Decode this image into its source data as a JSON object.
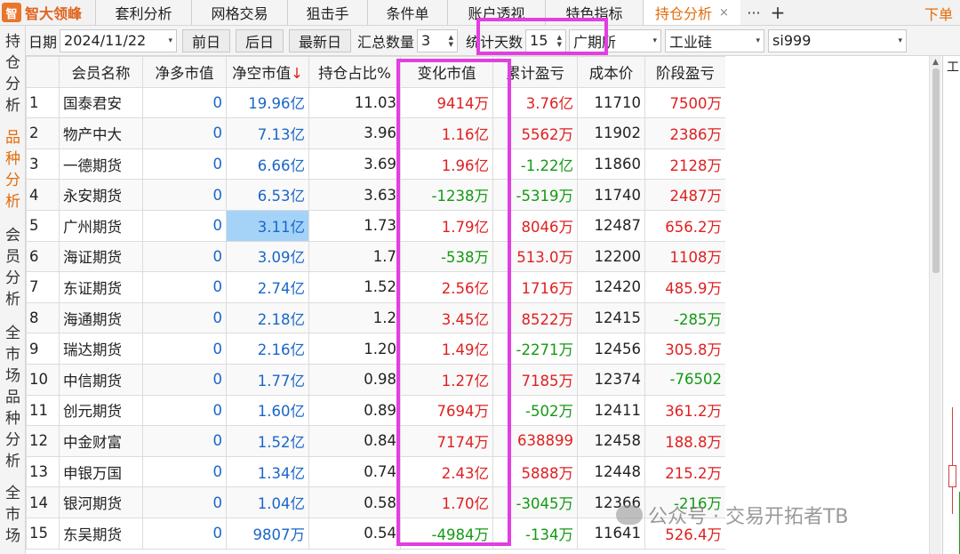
{
  "app": {
    "logo_mark": "智",
    "name": "智大领峰"
  },
  "tabs": [
    {
      "label": "套利分析"
    },
    {
      "label": "网格交易"
    },
    {
      "label": "狙击手"
    },
    {
      "label": "条件单"
    },
    {
      "label": "账户透视"
    },
    {
      "label": "特色指标"
    },
    {
      "label": "持仓分析",
      "active": true,
      "close": "×"
    }
  ],
  "tab_more": "···",
  "tab_add": "+",
  "order_button": "下单",
  "left_nav": [
    {
      "label": [
        "持",
        "仓",
        "分",
        "析"
      ]
    },
    {
      "label": [
        "品",
        "种",
        "分",
        "析"
      ],
      "active": true
    },
    {
      "label": [
        "会",
        "员",
        "分",
        "析"
      ]
    },
    {
      "label": [
        "全",
        "市",
        "场",
        "品",
        "种",
        "分",
        "析"
      ]
    },
    {
      "label": [
        "全",
        "市",
        "场"
      ]
    }
  ],
  "toolbar": {
    "date_label": "日期",
    "date_value": "2024/11/22",
    "prev_day": "前日",
    "next_day": "后日",
    "latest_day": "最新日",
    "sum_label": "汇总数量",
    "sum_value": "3",
    "days_label": "统计天数",
    "days_value": "15",
    "exchange_value": "广期所",
    "product_value": "工业硅",
    "contract_value": "si999"
  },
  "table": {
    "headers": [
      "会员名称",
      "净多市值",
      "净空市值",
      "持仓占比%",
      "变化市值",
      "累计盈亏",
      "成本价",
      "阶段盈亏"
    ],
    "sort_arrow": "↓",
    "rows": [
      {
        "idx": "1",
        "name": "国泰君安",
        "long": "0",
        "short": "19.96亿",
        "ratio": "11.03",
        "change": "9414万",
        "cum": "3.76亿",
        "cost": "11710",
        "stage": "7500万"
      },
      {
        "idx": "2",
        "name": "物产中大",
        "long": "0",
        "short": "7.13亿",
        "ratio": "3.96",
        "change": "1.16亿",
        "cum": "5562万",
        "cost": "11902",
        "stage": "2386万"
      },
      {
        "idx": "3",
        "name": "一德期货",
        "long": "0",
        "short": "6.66亿",
        "ratio": "3.69",
        "change": "1.96亿",
        "cum": "-1.22亿",
        "cost": "11860",
        "stage": "2128万"
      },
      {
        "idx": "4",
        "name": "永安期货",
        "long": "0",
        "short": "6.53亿",
        "ratio": "3.63",
        "change": "-1238万",
        "cum": "-5319万",
        "cost": "11740",
        "stage": "2487万"
      },
      {
        "idx": "5",
        "name": "广州期货",
        "long": "0",
        "short": "3.11亿",
        "ratio": "1.73",
        "change": "1.79亿",
        "cum": "8046万",
        "cost": "12487",
        "stage": "656.2万"
      },
      {
        "idx": "6",
        "name": "海证期货",
        "long": "0",
        "short": "3.09亿",
        "ratio": "1.7",
        "change": "-538万",
        "cum": "513.0万",
        "cost": "12200",
        "stage": "1108万"
      },
      {
        "idx": "7",
        "name": "东证期货",
        "long": "0",
        "short": "2.74亿",
        "ratio": "1.52",
        "change": "2.56亿",
        "cum": "1716万",
        "cost": "12420",
        "stage": "485.9万"
      },
      {
        "idx": "8",
        "name": "海通期货",
        "long": "0",
        "short": "2.18亿",
        "ratio": "1.2",
        "change": "3.45亿",
        "cum": "8522万",
        "cost": "12415",
        "stage": "-285万"
      },
      {
        "idx": "9",
        "name": "瑞达期货",
        "long": "0",
        "short": "2.16亿",
        "ratio": "1.20",
        "change": "1.49亿",
        "cum": "-2271万",
        "cost": "12456",
        "stage": "305.8万"
      },
      {
        "idx": "10",
        "name": "中信期货",
        "long": "0",
        "short": "1.77亿",
        "ratio": "0.98",
        "change": "1.27亿",
        "cum": "7185万",
        "cost": "12374",
        "stage": "-76502"
      },
      {
        "idx": "11",
        "name": "创元期货",
        "long": "0",
        "short": "1.60亿",
        "ratio": "0.89",
        "change": "7694万",
        "cum": "-502万",
        "cost": "12411",
        "stage": "361.2万"
      },
      {
        "idx": "12",
        "name": "中金财富",
        "long": "0",
        "short": "1.52亿",
        "ratio": "0.84",
        "change": "7174万",
        "cum": "638899",
        "cost": "12458",
        "stage": "188.8万"
      },
      {
        "idx": "13",
        "name": "申银万国",
        "long": "0",
        "short": "1.34亿",
        "ratio": "0.74",
        "change": "2.43亿",
        "cum": "5888万",
        "cost": "12448",
        "stage": "215.2万"
      },
      {
        "idx": "14",
        "name": "银河期货",
        "long": "0",
        "short": "1.04亿",
        "ratio": "0.58",
        "change": "1.70亿",
        "cum": "-3045万",
        "cost": "12366",
        "stage": "-216万"
      },
      {
        "idx": "15",
        "name": "东吴期货",
        "long": "0",
        "short": "9807万",
        "ratio": "0.54",
        "change": "-4984万",
        "cum": "-134万",
        "cost": "11641",
        "stage": "526.4万"
      }
    ]
  },
  "side_chart_label": "工",
  "watermark": "公众号 · 交易开拓者TB",
  "colors": {
    "accent": "#e36c0a",
    "positive": "#e02020",
    "negative": "#139a13",
    "value_blue": "#1a66c9",
    "highlight": "#e23ee0",
    "selected_cell": "#a5d3f8"
  }
}
